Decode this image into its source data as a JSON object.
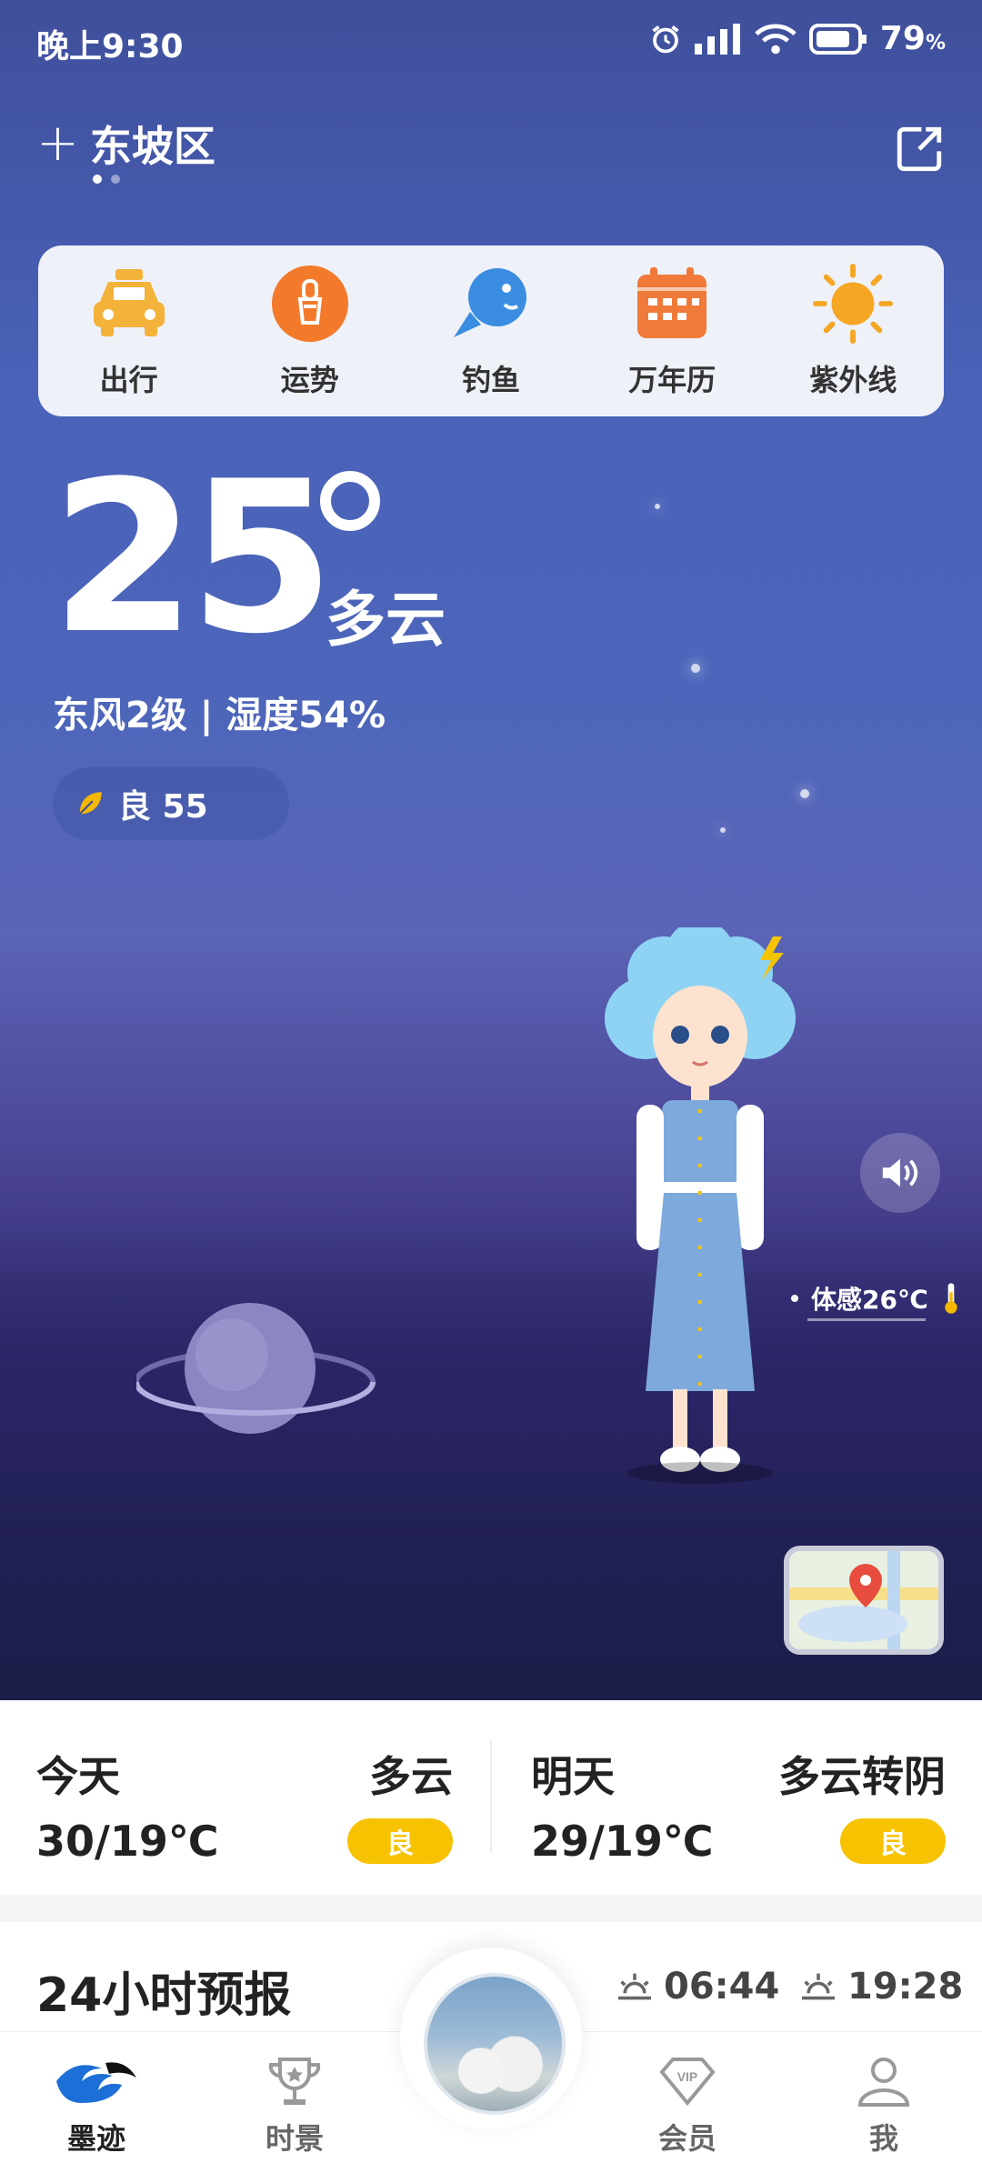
{
  "status_bar": {
    "time": "晚上9:30",
    "battery": "79",
    "battery_unit": "%"
  },
  "header": {
    "location": "东坡区"
  },
  "tools": [
    {
      "label": "出行",
      "icon": "taxi-icon"
    },
    {
      "label": "运势",
      "icon": "fortune-icon"
    },
    {
      "label": "钓鱼",
      "icon": "fish-icon"
    },
    {
      "label": "万年历",
      "icon": "calendar-icon"
    },
    {
      "label": "紫外线",
      "icon": "sun-icon"
    }
  ],
  "current": {
    "temperature": "25",
    "condition": "多云",
    "wind_humidity": "东风2级 | 湿度54%",
    "aqi": "良 55",
    "feels_like": "体感26℃"
  },
  "forecast": {
    "today": {
      "day": "今天",
      "weather": "多云",
      "range": "30/19℃",
      "aqi": "良"
    },
    "tomorrow": {
      "day": "明天",
      "weather": "多云转阴",
      "range": "29/19℃",
      "aqi": "良"
    }
  },
  "hourly": {
    "title": "24小时预报",
    "sunrise": "06:44",
    "sunset": "19:28"
  },
  "nav": [
    {
      "label": "墨迹",
      "icon": "moji-logo-icon"
    },
    {
      "label": "时景",
      "icon": "trophy-icon"
    },
    {
      "label": "会员",
      "icon": "vip-icon"
    },
    {
      "label": "我",
      "icon": "profile-icon"
    }
  ],
  "colors": {
    "aqi_badge": "#f7c200",
    "orange": "#f47a2b",
    "blue": "#3a8de0"
  }
}
